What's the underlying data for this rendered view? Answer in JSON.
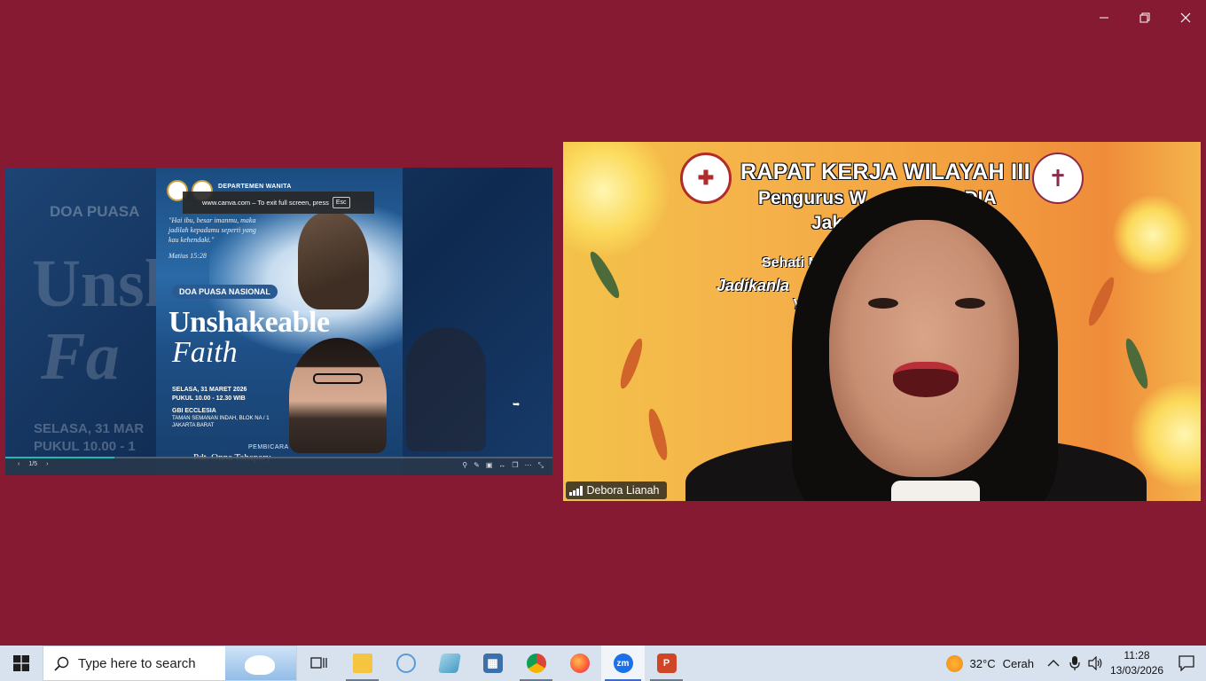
{
  "shared_screen": {
    "blur_texts": {
      "doa": "DOA PUASA",
      "uns": "Unsh",
      "fai": "Fa",
      "sel": "SELASA, 31 MAR",
      "puk": "PUKUL 10.00 - 1"
    },
    "poster": {
      "department": "DEPARTEMEN WANITA",
      "verse": "\"Hai ibu, besar imanmu, maka jadilah kepadamu seperti yang kau kehendaki.\"",
      "verse_ref": "Matius 15:28",
      "event_label": "DOA PUASA NASIONAL",
      "title_line1": "Unshakeable",
      "title_line2": "Faith",
      "date": "SELASA, 31 MARET 2026",
      "time": "PUKUL 10.00 - 12.30 WIB",
      "venue": "GBI ECCLESIA",
      "address1": "TAMAN SEMANAN INDAH, BLOK NA / 1",
      "address2": "JAKARTA BARAT",
      "speaker_label": "PEMBICARA",
      "speaker_name": "Pdt. Onna Tahapary"
    },
    "fullscreen_notice": "www.canva.com – To exit full screen, press",
    "fullscreen_key": "Esc",
    "page_indicator": "1/5",
    "progress": 0.2
  },
  "video": {
    "title": "RAPAT KERJA WILAYAH III",
    "subtitle1": "Pengurus W",
    "subtitle1_end": "DIA",
    "subtitle2": "Jak",
    "sehati": "Sehati M",
    "jadikan": "Jadikanla",
    "jadikan_end": "n",
    "y_line": "Y",
    "participant_name": "Debora Lianah"
  },
  "taskbar": {
    "search_placeholder": "Type here to search",
    "weather_temp": "32°C",
    "weather_desc": "Cerah",
    "time": "11:28",
    "date": "13/03/2026"
  },
  "colors": {
    "background": "#861a33",
    "taskbar": "#d8e2ef",
    "progress": "#23b8b2"
  }
}
